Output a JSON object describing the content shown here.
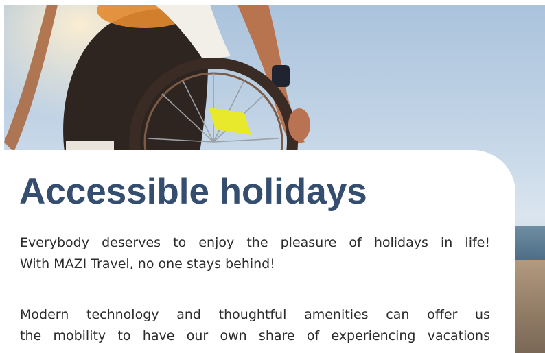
{
  "hero": {
    "image": "wheelchair-beach-photo"
  },
  "title": "Accessible holidays",
  "paragraphs": [
    {
      "lines": [
        "Everybody deserves to enjoy the pleasure of holidays in life!",
        "With MAZI Travel, no one stays behind!"
      ]
    },
    {
      "lines": [
        "Modern technology and thoughtful amenities can offer us",
        "the mobility to have our own share of experiencing vacations"
      ]
    }
  ],
  "colors": {
    "title": "#354d6f",
    "body_text": "#2b2b2b",
    "card": "#ffffff"
  }
}
